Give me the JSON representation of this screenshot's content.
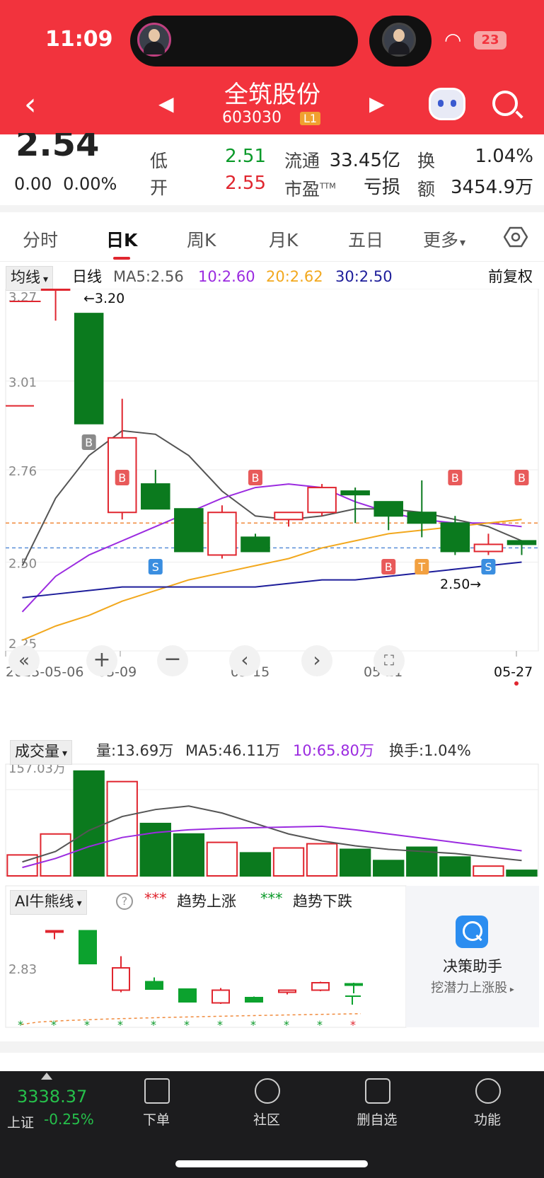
{
  "status": {
    "time": "11:09",
    "battery": "23"
  },
  "nav": {
    "title": "全筑股份",
    "code": "603030",
    "level": "L1"
  },
  "quote": {
    "price": "2.54",
    "change": "0.00",
    "change_pct": "0.00%",
    "rows": [
      {
        "l1": "低",
        "v1": "2.51",
        "l2": "流通",
        "v2": "33.45亿",
        "l3": "换",
        "v3": "1.04%"
      },
      {
        "l1": "开",
        "v1": "2.55",
        "l2": "市盈",
        "l2_sup": "TTM",
        "v2": "亏损",
        "l3": "额",
        "v3": "3454.9万"
      }
    ]
  },
  "tabs": [
    "分时",
    "日K",
    "周K",
    "月K",
    "五日",
    "更多"
  ],
  "active_tab": "日K",
  "ma_header": {
    "dropdown": "均线",
    "period": "日线",
    "ma5": "MA5:2.56",
    "ma10": "10:2.60",
    "ma20": "20:2.62",
    "ma30": "30:2.50",
    "adjust": "前复权"
  },
  "colors": {
    "up": "#e0262f",
    "down": "#0b7a1e",
    "ma5": "#555555",
    "ma10": "#9b2be0",
    "ma20": "#f2a81e",
    "ma30": "#1d1d9a",
    "brand": "#f2333d"
  },
  "chart_data": [
    {
      "type": "candlestick",
      "title": "日K",
      "y_ticks": [
        "3.27",
        "3.01",
        "2.76",
        "2.50",
        "2.25"
      ],
      "ylim": [
        2.25,
        3.27
      ],
      "x_ticks": [
        "2025-05-06",
        "05-09",
        "05-15",
        "05-21",
        "05-27"
      ],
      "annotations": {
        "high": "←3.20",
        "low": "2.50→"
      },
      "candles": [
        {
          "o": 3.27,
          "h": 3.27,
          "l": 3.18,
          "c": 3.27
        },
        {
          "o": 3.2,
          "h": 3.2,
          "l": 2.89,
          "c": 2.89
        },
        {
          "o": 2.64,
          "h": 2.96,
          "l": 2.62,
          "c": 2.85
        },
        {
          "o": 2.72,
          "h": 2.76,
          "l": 2.67,
          "c": 2.65
        },
        {
          "o": 2.65,
          "h": 2.65,
          "l": 2.55,
          "c": 2.53
        },
        {
          "o": 2.52,
          "h": 2.66,
          "l": 2.51,
          "c": 2.64
        },
        {
          "o": 2.57,
          "h": 2.58,
          "l": 2.53,
          "c": 2.53
        },
        {
          "o": 2.62,
          "h": 2.64,
          "l": 2.6,
          "c": 2.64
        },
        {
          "o": 2.64,
          "h": 2.72,
          "l": 2.63,
          "c": 2.71
        },
        {
          "o": 2.7,
          "h": 2.71,
          "l": 2.61,
          "c": 2.69
        },
        {
          "o": 2.67,
          "h": 2.67,
          "l": 2.59,
          "c": 2.63
        },
        {
          "o": 2.64,
          "h": 2.73,
          "l": 2.57,
          "c": 2.61
        },
        {
          "o": 2.61,
          "h": 2.63,
          "l": 2.52,
          "c": 2.53
        },
        {
          "o": 2.53,
          "h": 2.58,
          "l": 2.52,
          "c": 2.55
        },
        {
          "o": 2.56,
          "h": 2.56,
          "l": 2.52,
          "c": 2.55
        }
      ],
      "signals": [
        {
          "i": 2,
          "label": "B",
          "pos": "above",
          "color": "#8a8a8a"
        },
        {
          "i": 3,
          "label": "B",
          "pos": "above",
          "color": "#e85a5a"
        },
        {
          "i": 4,
          "label": "S",
          "pos": "below",
          "color": "#3a8ee0"
        },
        {
          "i": 7,
          "label": "B",
          "pos": "above",
          "color": "#e85a5a"
        },
        {
          "i": 11,
          "label": "B",
          "pos": "below",
          "color": "#e85a5a"
        },
        {
          "i": 12,
          "label": "T",
          "pos": "below",
          "color": "#f2a040"
        },
        {
          "i": 13,
          "label": "B",
          "pos": "above",
          "color": "#e85a5a"
        },
        {
          "i": 14,
          "label": "S",
          "pos": "below",
          "color": "#3a8ee0"
        },
        {
          "i": 15,
          "label": "B",
          "pos": "above",
          "color": "#e85a5a"
        }
      ],
      "series": [
        {
          "name": "MA5",
          "values": [
            2.49,
            2.68,
            2.8,
            2.87,
            2.86,
            2.8,
            2.7,
            2.63,
            2.62,
            2.63,
            2.65,
            2.65,
            2.64,
            2.62,
            2.6,
            2.56
          ]
        },
        {
          "name": "10",
          "values": [
            2.36,
            2.46,
            2.52,
            2.56,
            2.6,
            2.64,
            2.68,
            2.71,
            2.72,
            2.71,
            2.67,
            2.64,
            2.62,
            2.61,
            2.61,
            2.6
          ]
        },
        {
          "name": "20",
          "values": [
            2.28,
            2.32,
            2.35,
            2.39,
            2.42,
            2.45,
            2.47,
            2.49,
            2.51,
            2.54,
            2.56,
            2.58,
            2.59,
            2.6,
            2.61,
            2.62
          ]
        },
        {
          "name": "30",
          "values": [
            2.4,
            2.41,
            2.42,
            2.43,
            2.43,
            2.43,
            2.43,
            2.43,
            2.44,
            2.45,
            2.45,
            2.46,
            2.47,
            2.48,
            2.49,
            2.5
          ]
        }
      ],
      "ref_lines": [
        2.61,
        2.54
      ]
    },
    {
      "type": "bar",
      "title": "成交量",
      "y_ticks": [
        "157.03万"
      ],
      "legend": {
        "vol": "量:13.69万",
        "ma5": "MA5:46.11万",
        "ma10": "10:65.80万",
        "turnover": "换手:1.04%"
      },
      "values": [
        30,
        60,
        150,
        135,
        75,
        60,
        48,
        33,
        40,
        46,
        38,
        22,
        41,
        27,
        14,
        8
      ],
      "up": [
        true,
        true,
        false,
        true,
        false,
        false,
        true,
        false,
        true,
        true,
        false,
        false,
        false,
        false,
        true,
        false
      ],
      "ma5": [
        20,
        35,
        65,
        85,
        95,
        100,
        90,
        75,
        60,
        50,
        43,
        38,
        35,
        32,
        27,
        22
      ],
      "ma10": [
        12,
        25,
        42,
        55,
        62,
        66,
        68,
        69,
        70,
        71,
        66,
        60,
        54,
        48,
        42,
        36
      ],
      "ymax": 160
    },
    {
      "type": "candlestick",
      "title": "AI牛熊线",
      "y_ticks": [
        "2.83"
      ],
      "legend": {
        "up": "趋势上涨",
        "down": "趋势下跌"
      },
      "candles": [
        {
          "o": 3.2,
          "h": 3.2,
          "l": 3.12,
          "c": 3.2
        },
        {
          "o": 3.2,
          "h": 3.2,
          "l": 2.89,
          "c": 2.89
        },
        {
          "o": 2.64,
          "h": 2.96,
          "l": 2.62,
          "c": 2.85
        },
        {
          "o": 2.72,
          "h": 2.76,
          "l": 2.67,
          "c": 2.65
        },
        {
          "o": 2.65,
          "h": 2.65,
          "l": 2.55,
          "c": 2.53
        },
        {
          "o": 2.52,
          "h": 2.66,
          "l": 2.51,
          "c": 2.64
        },
        {
          "o": 2.57,
          "h": 2.58,
          "l": 2.53,
          "c": 2.53
        },
        {
          "o": 2.62,
          "h": 2.64,
          "l": 2.6,
          "c": 2.64
        },
        {
          "o": 2.64,
          "h": 2.72,
          "l": 2.63,
          "c": 2.71
        },
        {
          "o": 2.7,
          "h": 2.71,
          "l": 2.61,
          "c": 2.69
        }
      ]
    }
  ],
  "chart_controls": [
    "double-left-icon",
    "plus-icon",
    "minus-icon",
    "chevron-left-icon",
    "chevron-right-icon",
    "fullscreen-icon"
  ],
  "decision": {
    "title": "决策助手",
    "sub": "挖潜力上涨股"
  },
  "index": {
    "value": "3338.37",
    "name": "上证",
    "change": "-0.25%"
  },
  "bottom_nav": [
    "下单",
    "社区",
    "删自选",
    "功能"
  ]
}
